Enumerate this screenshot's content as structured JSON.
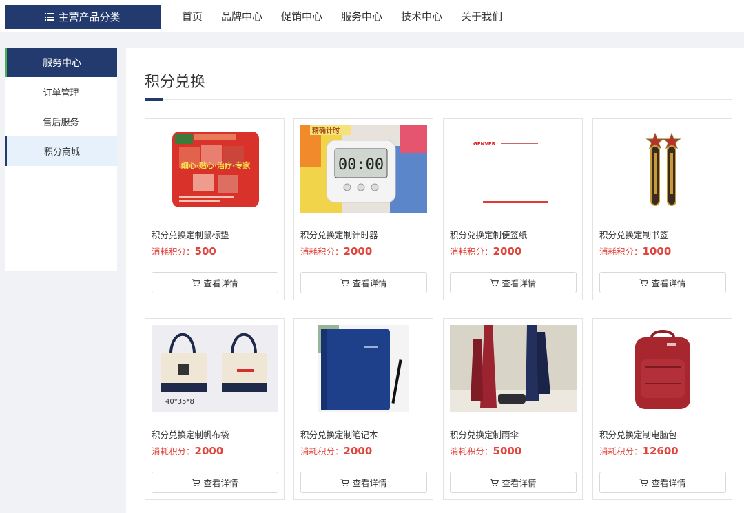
{
  "header": {
    "category_button": "主营产品分类",
    "nav": [
      "首页",
      "品牌中心",
      "促销中心",
      "服务中心",
      "技术中心",
      "关于我们"
    ]
  },
  "sidebar": {
    "title": "服务中心",
    "items": [
      {
        "label": "订单管理",
        "active": false
      },
      {
        "label": "售后服务",
        "active": false
      },
      {
        "label": "积分商城",
        "active": true
      }
    ]
  },
  "main": {
    "title": "积分兑换",
    "points_label": "消耗积分：",
    "detail_button": "查看详情",
    "products": [
      {
        "name": "积分兑换定制鼠标垫",
        "points": "500"
      },
      {
        "name": "积分兑换定制计时器",
        "points": "2000"
      },
      {
        "name": "积分兑换定制便签纸",
        "points": "2000"
      },
      {
        "name": "积分兑换定制书签",
        "points": "1000"
      },
      {
        "name": "积分兑换定制帆布袋",
        "points": "2000"
      },
      {
        "name": "积分兑换定制笔记本",
        "points": "2000"
      },
      {
        "name": "积分兑换定制雨伞",
        "points": "5000"
      },
      {
        "name": "积分兑换定制电脑包",
        "points": "12600"
      }
    ]
  },
  "images": {
    "mousepad_text": "细心·贴心·治疗·专家",
    "timer_text": "精确计时",
    "notepad_brand": "GENVER",
    "bag_size": "40*35*8"
  },
  "colors": {
    "brand_navy": "#223a6e",
    "points_red": "#e0443b",
    "active_bg": "#e6f1fc"
  }
}
